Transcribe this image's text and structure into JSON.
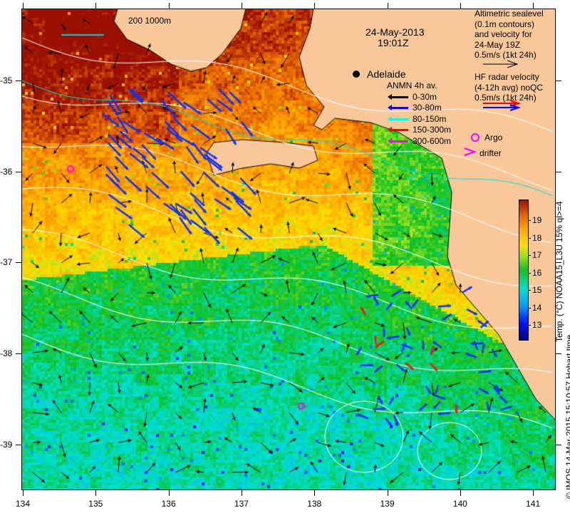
{
  "map": {
    "date": "24-May-2013",
    "time": "19:01Z",
    "scale_label": "200  1000m",
    "city": "Adelaide",
    "lon_ticks": [
      "134",
      "135",
      "136",
      "137",
      "138",
      "139",
      "140",
      "141"
    ],
    "lat_ticks": [
      "-35",
      "-36",
      "-37",
      "-38",
      "-39"
    ]
  },
  "legend": {
    "altimetry": [
      "Altimetric sealevel",
      "(0.1m contours)",
      "and velocity for",
      "24-May 19Z",
      "0.5m/s (1kt 24h)"
    ],
    "hf_radar": [
      "HF radar velocity",
      "(4-12h avg) noQC",
      "0.5m/s (1kt 24h)"
    ],
    "anmn_title": "ANMN 4h av.",
    "anmn": [
      {
        "label": "0-30m",
        "color": "#000000"
      },
      {
        "label": "30-80m",
        "color": "#0000ff"
      },
      {
        "label": "80-150m",
        "color": "#00ffff"
      },
      {
        "label": "150-300m",
        "color": "#ff0000"
      },
      {
        "label": "300-600m",
        "color": "#ff00ff"
      }
    ],
    "argo": "Argo",
    "drifter": "drifter"
  },
  "colorbar": {
    "ticks": [
      "13",
      "14",
      "15",
      "16",
      "17",
      "18",
      "19"
    ],
    "label": "Temp. (°C) NOAA15_L3U 15% ql>=4",
    "range": [
      12.2,
      20.2
    ]
  },
  "credit": "© IMOS 14-Mar-2015 15:10:57 Hobart time",
  "colors": {
    "land": "#f9c89a",
    "contour": "#ffffff"
  }
}
